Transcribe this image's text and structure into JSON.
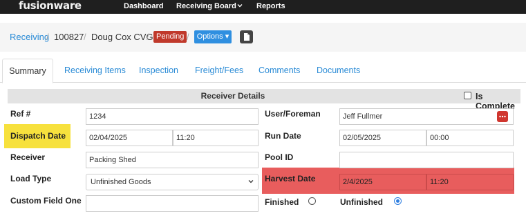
{
  "nav": {
    "logo": "fusionware",
    "links": [
      "Dashboard",
      "Receiving Board",
      "Reports"
    ]
  },
  "breadcrumb": {
    "root": "Receiving",
    "id": "100827",
    "name": "Doug Cox CVG",
    "status": "Pending",
    "options_label": "Options ▾"
  },
  "tabs": [
    "Summary",
    "Receiving Items",
    "Inspection",
    "Freight/Fees",
    "Comments",
    "Documents"
  ],
  "section": {
    "title": "Receiver Details",
    "is_complete_label": "Is Complete",
    "is_complete": false
  },
  "form": {
    "ref_label": "Ref #",
    "ref_value": "1234",
    "dispatch_label": "Dispatch Date",
    "dispatch_date": "02/04/2025",
    "dispatch_time": "11:20",
    "receiver_label": "Receiver",
    "receiver_value": "Packing Shed",
    "load_type_label": "Load Type",
    "load_type_value": "Unfinished Goods",
    "custom_label": "Custom Field One",
    "custom_value": "",
    "user_label": "User/Foreman",
    "user_value": "Jeff Fullmer",
    "run_label": "Run Date",
    "run_date": "02/05/2025",
    "run_time": "00:00",
    "pool_label": "Pool ID",
    "pool_value": "",
    "harvest_label": "Harvest Date",
    "harvest_date": "2/4/2025",
    "harvest_time": "11:20",
    "finished_label": "Finished",
    "unfinished_label": "Unfinished",
    "selected_finish": "Unfinished"
  },
  "colors": {
    "topbar": "#1f1f1f",
    "link": "#2a8bd6",
    "pending": "#c0392b",
    "options": "#2f8fe0",
    "highlight_yellow": "#f7e13d",
    "highlight_red": "#e85d5d"
  }
}
